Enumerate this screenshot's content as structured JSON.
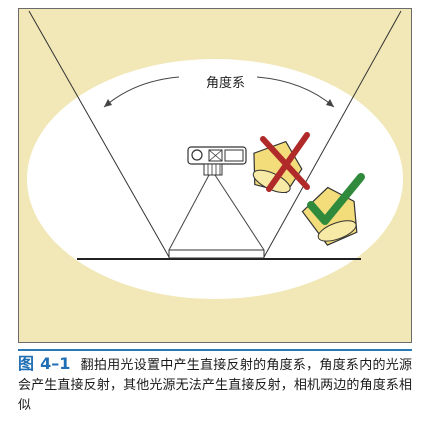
{
  "figure": {
    "label": "角度系"
  },
  "caption": {
    "number": "图 4–1",
    "text": "翻拍用光设置中产生直接反射的角度系，角度系内的光源会产生直接反射，其他光源无法产生直接反射，相机两边的角度系相似"
  },
  "colors": {
    "panel_background": "#f2e7b7",
    "ellipse": "#ffffff",
    "lamp_yellow": "#f2dd7a",
    "wrong_mark": "#b02a2a",
    "right_mark": "#2f8a3c",
    "caption_accent": "#1f6fb4"
  },
  "icons": {
    "camera": "camera-icon",
    "wrong_light": "cross-icon",
    "right_light": "check-icon"
  }
}
